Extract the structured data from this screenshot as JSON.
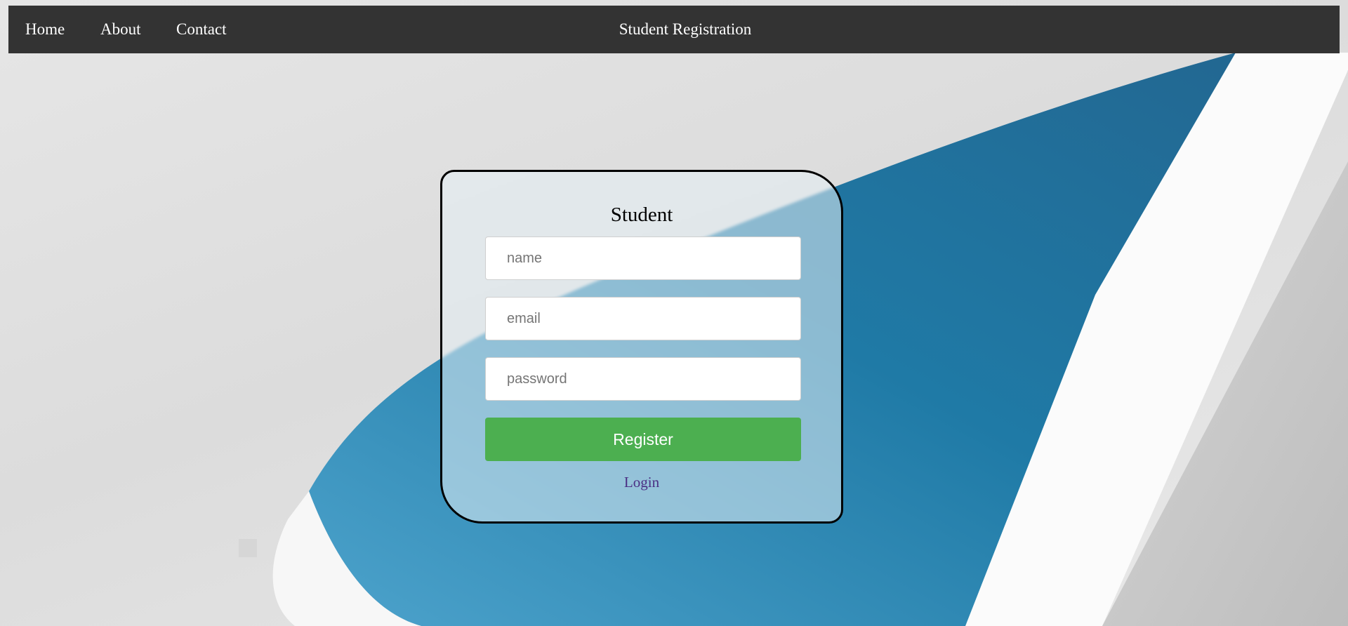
{
  "nav": {
    "links": [
      "Home",
      "About",
      "Contact"
    ],
    "title": "Student Registration"
  },
  "form": {
    "title": "Student",
    "fields": {
      "name_placeholder": "name",
      "email_placeholder": "email",
      "password_placeholder": "password"
    },
    "register_label": "Register",
    "login_label": "Login"
  },
  "colors": {
    "navbar": "#333333",
    "register_button": "#4caf50",
    "login_link": "#4b2f84",
    "accent_blue": "#1f7aa6"
  }
}
